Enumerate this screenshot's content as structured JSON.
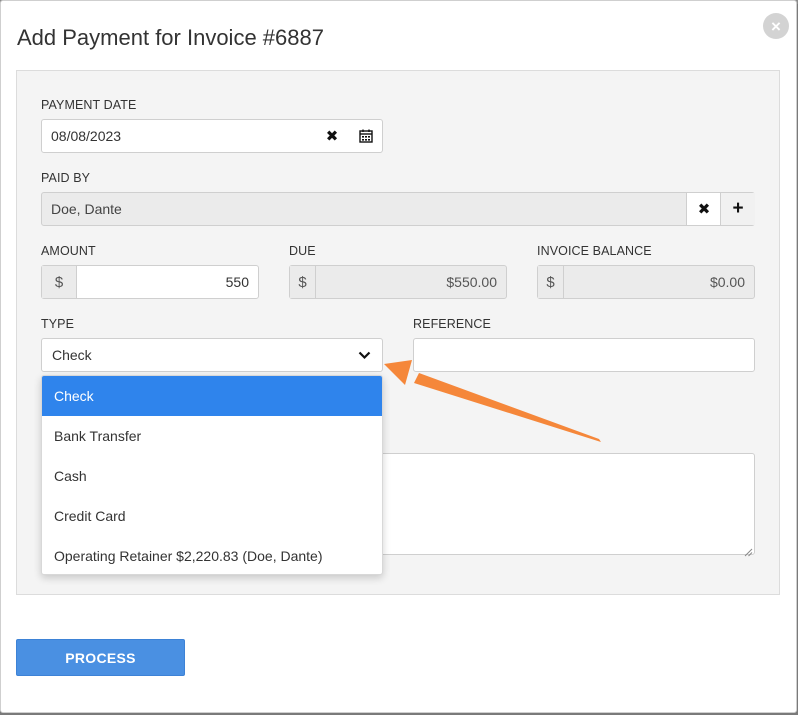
{
  "modal": {
    "title": "Add Payment for Invoice #6887",
    "close_glyph": "×"
  },
  "form": {
    "payment_date": {
      "label": "PAYMENT DATE",
      "value": "08/08/2023"
    },
    "paid_by": {
      "label": "PAID BY",
      "value": "Doe, Dante"
    },
    "amount": {
      "label": "AMOUNT",
      "prefix": "$",
      "value": "550"
    },
    "due": {
      "label": "DUE",
      "prefix": "$",
      "value": "$550.00"
    },
    "invoice_balance": {
      "label": "INVOICE BALANCE",
      "prefix": "$",
      "value": "$0.00"
    },
    "type": {
      "label": "TYPE",
      "selected": "Check",
      "options": [
        "Check",
        "Bank Transfer",
        "Cash",
        "Credit Card",
        "Operating Retainer $2,220.83 (Doe, Dante)"
      ]
    },
    "reference": {
      "label": "REFERENCE",
      "value": ""
    },
    "notes": {
      "value": ""
    }
  },
  "actions": {
    "process_label": "PROCESS"
  },
  "colors": {
    "accent": "#4a90e2",
    "selected_option": "#2f84ec",
    "annotation_arrow": "#f5873a"
  }
}
